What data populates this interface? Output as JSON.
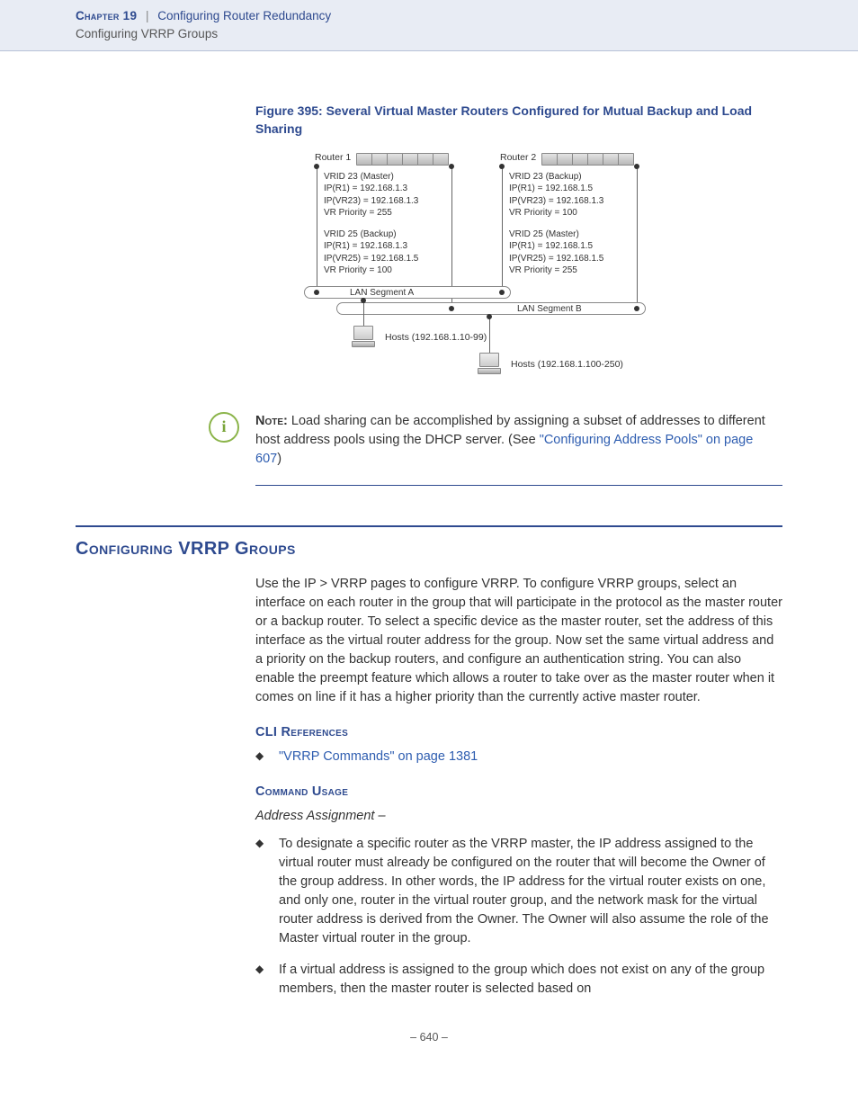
{
  "header": {
    "chapter_strong": "Chapter 19",
    "separator": "|",
    "chapter_title": "Configuring Router Redundancy",
    "subtitle": "Configuring VRRP Groups"
  },
  "figure": {
    "caption": "Figure 395:  Several Virtual Master Routers Configured for Mutual Backup and Load Sharing",
    "router1_label": "Router 1",
    "router2_label": "Router 2",
    "r1_v23": {
      "l1": "VRID 23 (Master)",
      "l2": "IP(R1) = 192.168.1.3",
      "l3": "IP(VR23) = 192.168.1.3",
      "l4": "VR Priority = 255"
    },
    "r1_v25": {
      "l1": "VRID 25 (Backup)",
      "l2": "IP(R1) = 192.168.1.3",
      "l3": "IP(VR25) = 192.168.1.5",
      "l4": "VR Priority = 100"
    },
    "r2_v23": {
      "l1": "VRID 23 (Backup)",
      "l2": "IP(R1) = 192.168.1.5",
      "l3": "IP(VR23) = 192.168.1.3",
      "l4": "VR Priority = 100"
    },
    "r2_v25": {
      "l1": "VRID 25 (Master)",
      "l2": "IP(R1) = 192.168.1.5",
      "l3": "IP(VR25) = 192.168.1.5",
      "l4": "VR Priority = 255"
    },
    "lan_a": "LAN Segment A",
    "lan_b": "LAN Segment B",
    "hosts_a": "Hosts (192.168.1.10-99)",
    "hosts_b": "Hosts (192.168.1.100-250)"
  },
  "note": {
    "icon": "i",
    "label": "Note:",
    "text": " Load sharing can be accomplished by assigning a subset of addresses to different host address pools using the DHCP server. (See ",
    "link": "\"Configuring Address Pools\" on page 607",
    "after": ")"
  },
  "section": {
    "heading": "Configuring VRRP Groups",
    "intro": "Use the IP > VRRP pages to configure VRRP. To configure VRRP groups, select an interface on each router in the group that will participate in the protocol as the master router or a backup router. To select a specific device as the master router, set the address of this interface as the virtual router address for the group. Now set the same virtual address and a priority on the backup routers, and configure an authentication string. You can also enable the preempt feature which allows a router to take over as the master router when it comes on line if it has a higher priority than the currently active master router.",
    "cli_head": "CLI References",
    "cli_link": "\"VRRP Commands\" on page 1381",
    "usage_head": "Command Usage",
    "usage_sub": "Address Assignment –",
    "bullet1": "To designate a specific router as the VRRP master, the IP address assigned to the virtual router must already be configured on the router that will become the Owner of the group address. In other words, the IP address for the virtual router exists on one, and only one, router in the virtual router group, and the network mask for the virtual router address is derived from the Owner. The Owner will also assume the role of the Master virtual router in the group.",
    "bullet2": "If a virtual address is assigned to the group which does not exist on any of the group members, then the master router is selected based on"
  },
  "pagenum": "–  640  –"
}
